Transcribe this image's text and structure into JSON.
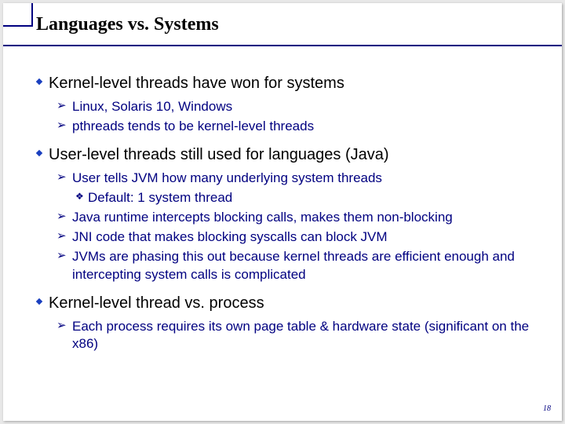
{
  "title": "Languages vs. Systems",
  "page": "18",
  "p1": {
    "head": "Kernel-level threads have won for systems",
    "s1": "Linux, Solaris 10, Windows",
    "s2": "pthreads tends to be kernel-level threads"
  },
  "p2": {
    "head": "User-level threads still used for languages (Java)",
    "s1": "User tells JVM how many underlying system threads",
    "s1a": "Default: 1 system thread",
    "s2": "Java runtime intercepts blocking calls, makes them non-blocking",
    "s3": "JNI code that makes blocking syscalls can block JVM",
    "s4": "JVMs are phasing this out because kernel threads are efficient enough and intercepting system calls is complicated"
  },
  "p3": {
    "head": "Kernel-level thread vs. process",
    "s1": "Each process requires its own page table & hardware state (significant on the x86)"
  }
}
